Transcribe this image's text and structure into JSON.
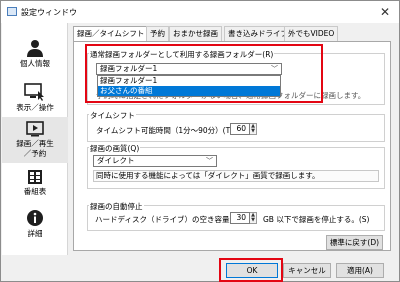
{
  "window": {
    "title": "設定ウィンドウ",
    "close_glyph": "✕"
  },
  "sidebar": {
    "items": [
      {
        "label": "個人情報",
        "icon": "person-icon"
      },
      {
        "label": "表示／操作",
        "icon": "display-icon"
      },
      {
        "label": "録画／再生\n／予約",
        "icon": "record-play-icon"
      },
      {
        "label": "番組表",
        "icon": "program-guide-icon"
      },
      {
        "label": "詳細",
        "icon": "info-icon"
      }
    ]
  },
  "tabs": [
    {
      "label": "録画／タイムシフト",
      "active": true
    },
    {
      "label": "予約"
    },
    {
      "label": "おまかせ録画"
    },
    {
      "label": "書き込みドライブ"
    },
    {
      "label": "外でもVIDEO"
    }
  ],
  "folder_group": {
    "title": "通常録画フォルダーとして利用する録画フォルダー(R)",
    "selected": "録画フォルダー1",
    "options": [
      "録画フォルダー1",
      "お父さんの番組"
    ],
    "highlighted_option": "お父さんの番組",
    "obscured_text": "予約時に指定されたフォルダーがない場合、通常録画フォルダーに録画します。"
  },
  "timeshift_group": {
    "title": "タイムシフト",
    "label": "タイムシフト可能時間（1分～90分）(T)",
    "value": "60"
  },
  "quality_group": {
    "title": "録画の画質(Q)",
    "selected": "ダイレクト",
    "description": "同時に使用する機能によっては「ダイレクト」画質で録画します。"
  },
  "autostop_group": {
    "title": "録画の自動停止",
    "label": "ハードディスク（ドライブ）の空き容量が",
    "value": "30",
    "suffix": "GB 以下で録画を停止する。(S)"
  },
  "buttons": {
    "restore": "標準に戻す(D)",
    "ok": "OK",
    "cancel": "キャンセル",
    "apply": "適用(A)"
  },
  "colors": {
    "highlight": "#e30613",
    "selection": "#0078d7"
  }
}
